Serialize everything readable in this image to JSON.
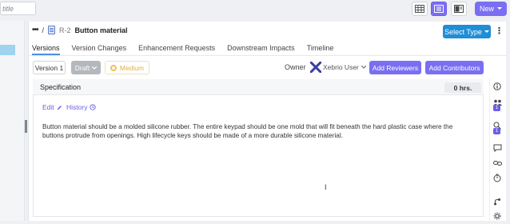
{
  "toolbar": {
    "search_placeholder": "title",
    "new_label": "New"
  },
  "breadcrumb": {
    "ellipsis": "•••",
    "separator": "/",
    "req_id": "R-2",
    "title": "Button material"
  },
  "header": {
    "select_type_label": "Select Type",
    "more_label": "⋮"
  },
  "tabs": [
    {
      "label": "Versions",
      "active": true
    },
    {
      "label": "Version Changes",
      "active": false
    },
    {
      "label": "Enhancement Requests",
      "active": false
    },
    {
      "label": "Downstream Impacts",
      "active": false
    },
    {
      "label": "Timeline",
      "active": false
    }
  ],
  "meta": {
    "version_label": "Version 1",
    "status_label": "Draft",
    "priority_label": "Medium",
    "owner_label": "Owner",
    "owner_name": "Xebrio User",
    "add_reviewers_label": "Add Reviewers",
    "add_contributors_label": "Add Contributors"
  },
  "specification": {
    "title": "Specification",
    "hours": "0 hrs.",
    "edit_label": "Edit",
    "history_label": "History",
    "body": "Button material should be a molded silicone rubber. The entire keypad should be one mold that will fit beneath the hard plastic case where the buttons protrude from openings.  High lifecycle keys should be made of a more durable silicone material."
  },
  "right_rail": {
    "badge_1": "1",
    "badge_2": "1"
  },
  "colors": {
    "accent_purple": "#7a6ff2",
    "select_blue": "#1f8ed6",
    "tab_underline": "#4a90e2",
    "priority_yellow": "#f2c14c"
  },
  "icons": {
    "grid_view": "grid-icon",
    "list_view": "list-icon",
    "panel_view": "panel-icon",
    "info": "info-icon",
    "reviewers": "users-icon",
    "contributors": "user-search-icon",
    "comments": "comment-icon",
    "link": "link-icon",
    "timer": "timer-icon",
    "branch": "branch-icon",
    "settings": "gear-icon"
  }
}
